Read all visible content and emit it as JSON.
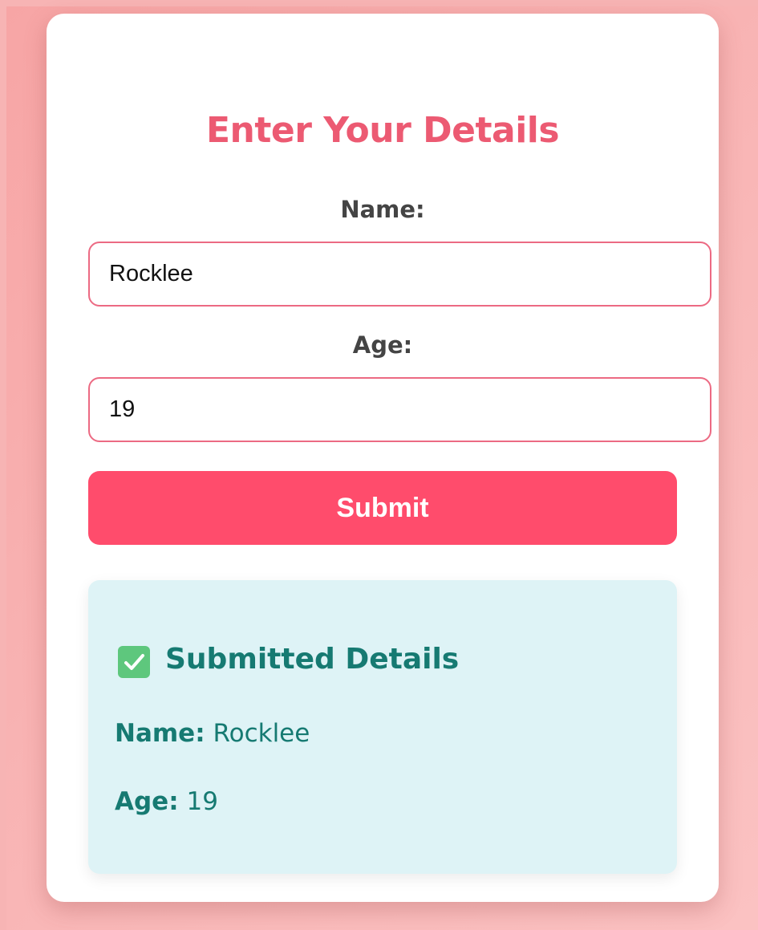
{
  "form": {
    "title": "Enter Your Details",
    "name_label": "Name:",
    "name_value": "Rocklee",
    "age_label": "Age:",
    "age_value": "19",
    "submit_label": "Submit"
  },
  "submitted": {
    "heading": "Submitted Details",
    "name_key": "Name:",
    "name_value": "Rocklee",
    "age_key": "Age:",
    "age_value": "19",
    "icon": "check-box-icon"
  },
  "colors": {
    "background": "#f7b4b4",
    "accent": "#ff4c6c",
    "title": "#ec5a72",
    "panel": "#def3f6",
    "panel_text": "#167a72"
  }
}
